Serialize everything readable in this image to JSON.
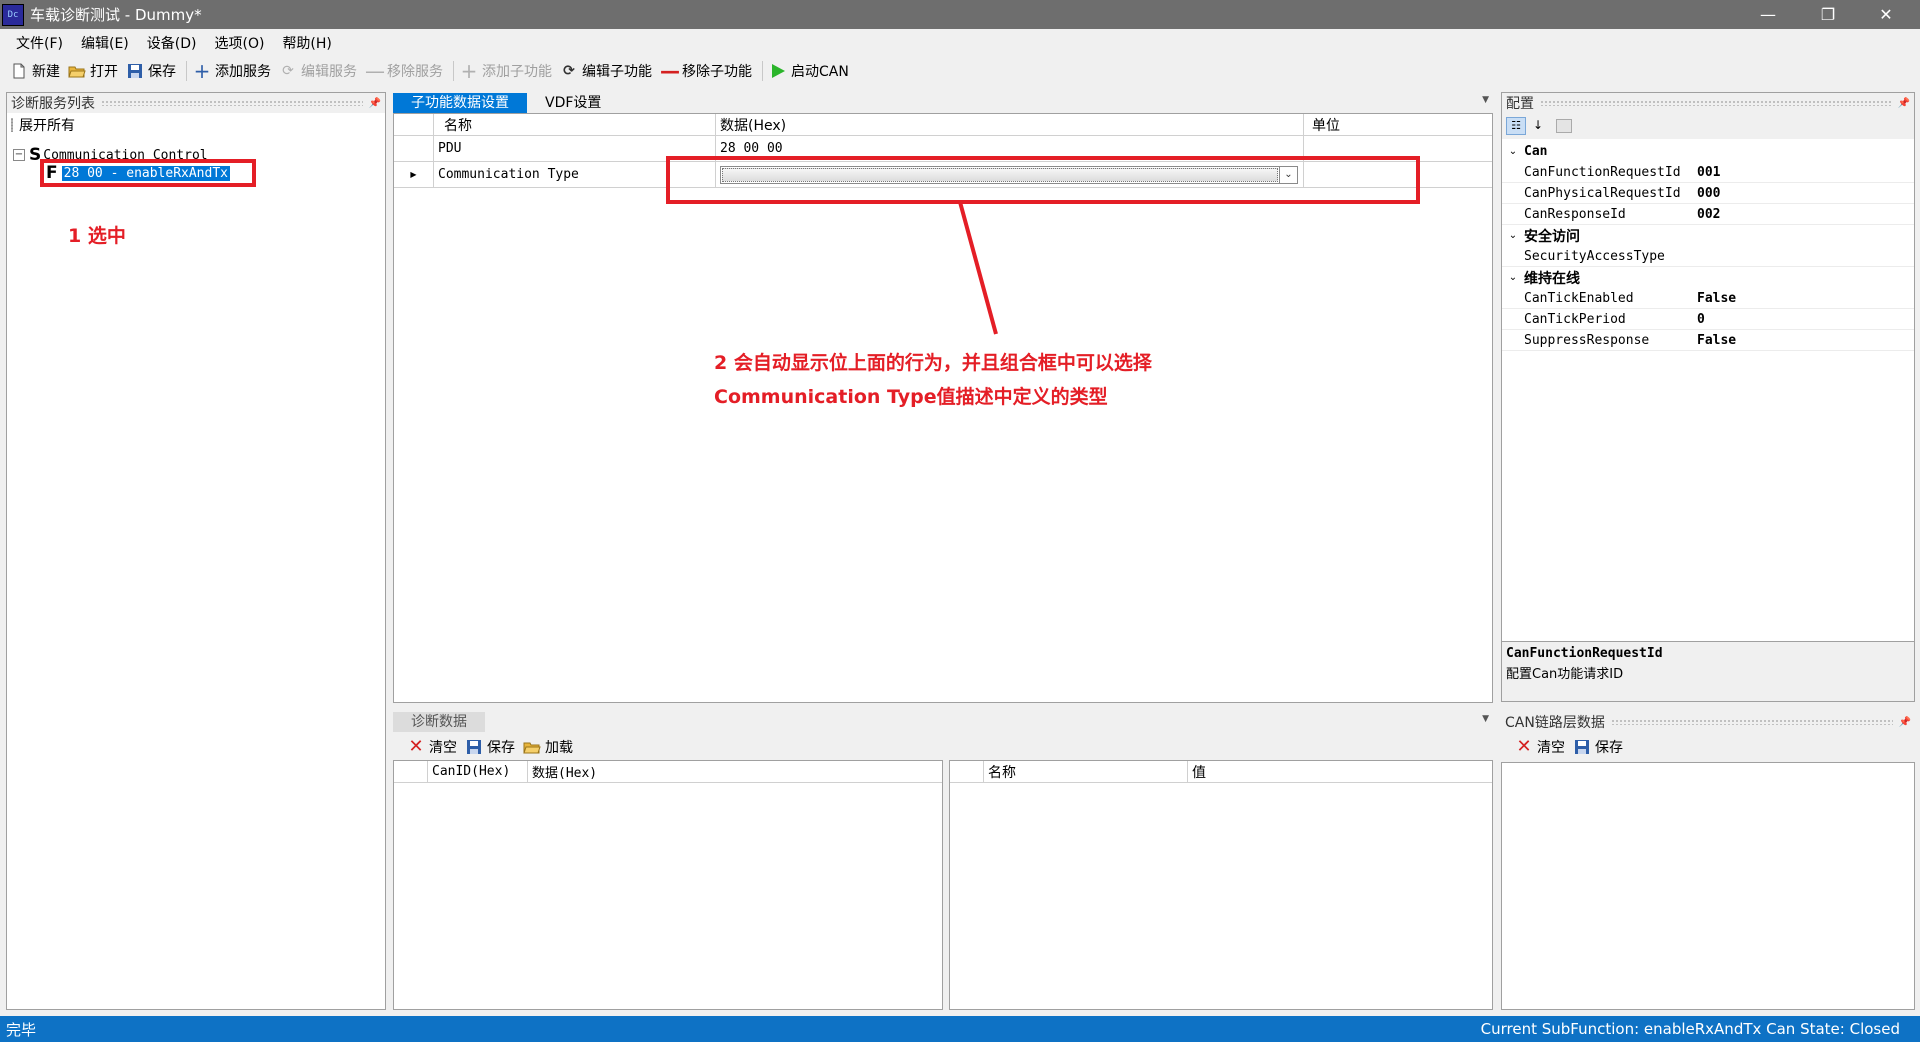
{
  "window": {
    "icon_text": "Dc",
    "title": "车载诊断测试 - Dummy*",
    "minimize": "—",
    "restore": "❐",
    "close": "✕"
  },
  "menu": [
    "文件(F)",
    "编辑(E)",
    "设备(D)",
    "选项(O)",
    "帮助(H)"
  ],
  "toolbar": {
    "new": "新建",
    "open": "打开",
    "save": "保存",
    "add_service": "添加服务",
    "edit_service": "编辑服务",
    "remove_service": "移除服务",
    "add_subfunc": "添加子功能",
    "edit_subfunc": "编辑子功能",
    "remove_subfunc": "移除子功能",
    "start_can": "启动CAN"
  },
  "left_panel": {
    "title": "诊断服务列表",
    "pin": "📌",
    "expand_all": "展开所有",
    "tree_node_icon": "S",
    "tree_node_label": "Communication Control",
    "child_icon": "F",
    "child_label": "28 00 - enableRxAndTx",
    "collapse_glyph": "⊟"
  },
  "center_tabs": [
    "子功能数据设置",
    "VDF设置"
  ],
  "subfunc_grid": {
    "headers": [
      "名称",
      "数据(Hex)",
      "单位"
    ],
    "rows": [
      {
        "name": "PDU",
        "data": "28 00 00",
        "unit": ""
      },
      {
        "name": "Communication Type",
        "data": "",
        "unit": ""
      }
    ]
  },
  "config_panel": {
    "title": "配置",
    "categories": [
      {
        "name": "Can",
        "props": [
          {
            "key": "CanFunctionRequestId",
            "value": "001"
          },
          {
            "key": "CanPhysicalRequestId",
            "value": "000"
          },
          {
            "key": "CanResponseId",
            "value": "002"
          }
        ]
      },
      {
        "name": "安全访问",
        "props": [
          {
            "key": "SecurityAccessType",
            "value": ""
          }
        ]
      },
      {
        "name": "维持在线",
        "props": [
          {
            "key": "CanTickEnabled",
            "value": "False"
          },
          {
            "key": "CanTickPeriod",
            "value": "0"
          },
          {
            "key": "SuppressResponse",
            "value": "False"
          }
        ]
      }
    ],
    "desc_title": "CanFunctionRequestId",
    "desc_text": "配置Can功能请求ID"
  },
  "diag_panel": {
    "tab": "诊断数据",
    "clear": "清空",
    "save": "保存",
    "load": "加载",
    "left_headers": [
      "CanID(Hex)",
      "数据(Hex)"
    ],
    "right_headers": [
      "名称",
      "值"
    ]
  },
  "can_panel": {
    "title": "CAN链路层数据",
    "clear": "清空",
    "save": "保存"
  },
  "status": {
    "left": "完毕",
    "right": "Current SubFunction: enableRxAndTx  Can State: Closed"
  },
  "annotations": {
    "a1": "1 选中",
    "a2_line1": "2 会自动显示位上面的行为，并且组合框中可以选择",
    "a2_line2": "Communication Type值描述中定义的类型"
  },
  "colors": {
    "accent": "#0078d7",
    "annotation": "#e41e26",
    "statusbar": "#0e72c5"
  }
}
